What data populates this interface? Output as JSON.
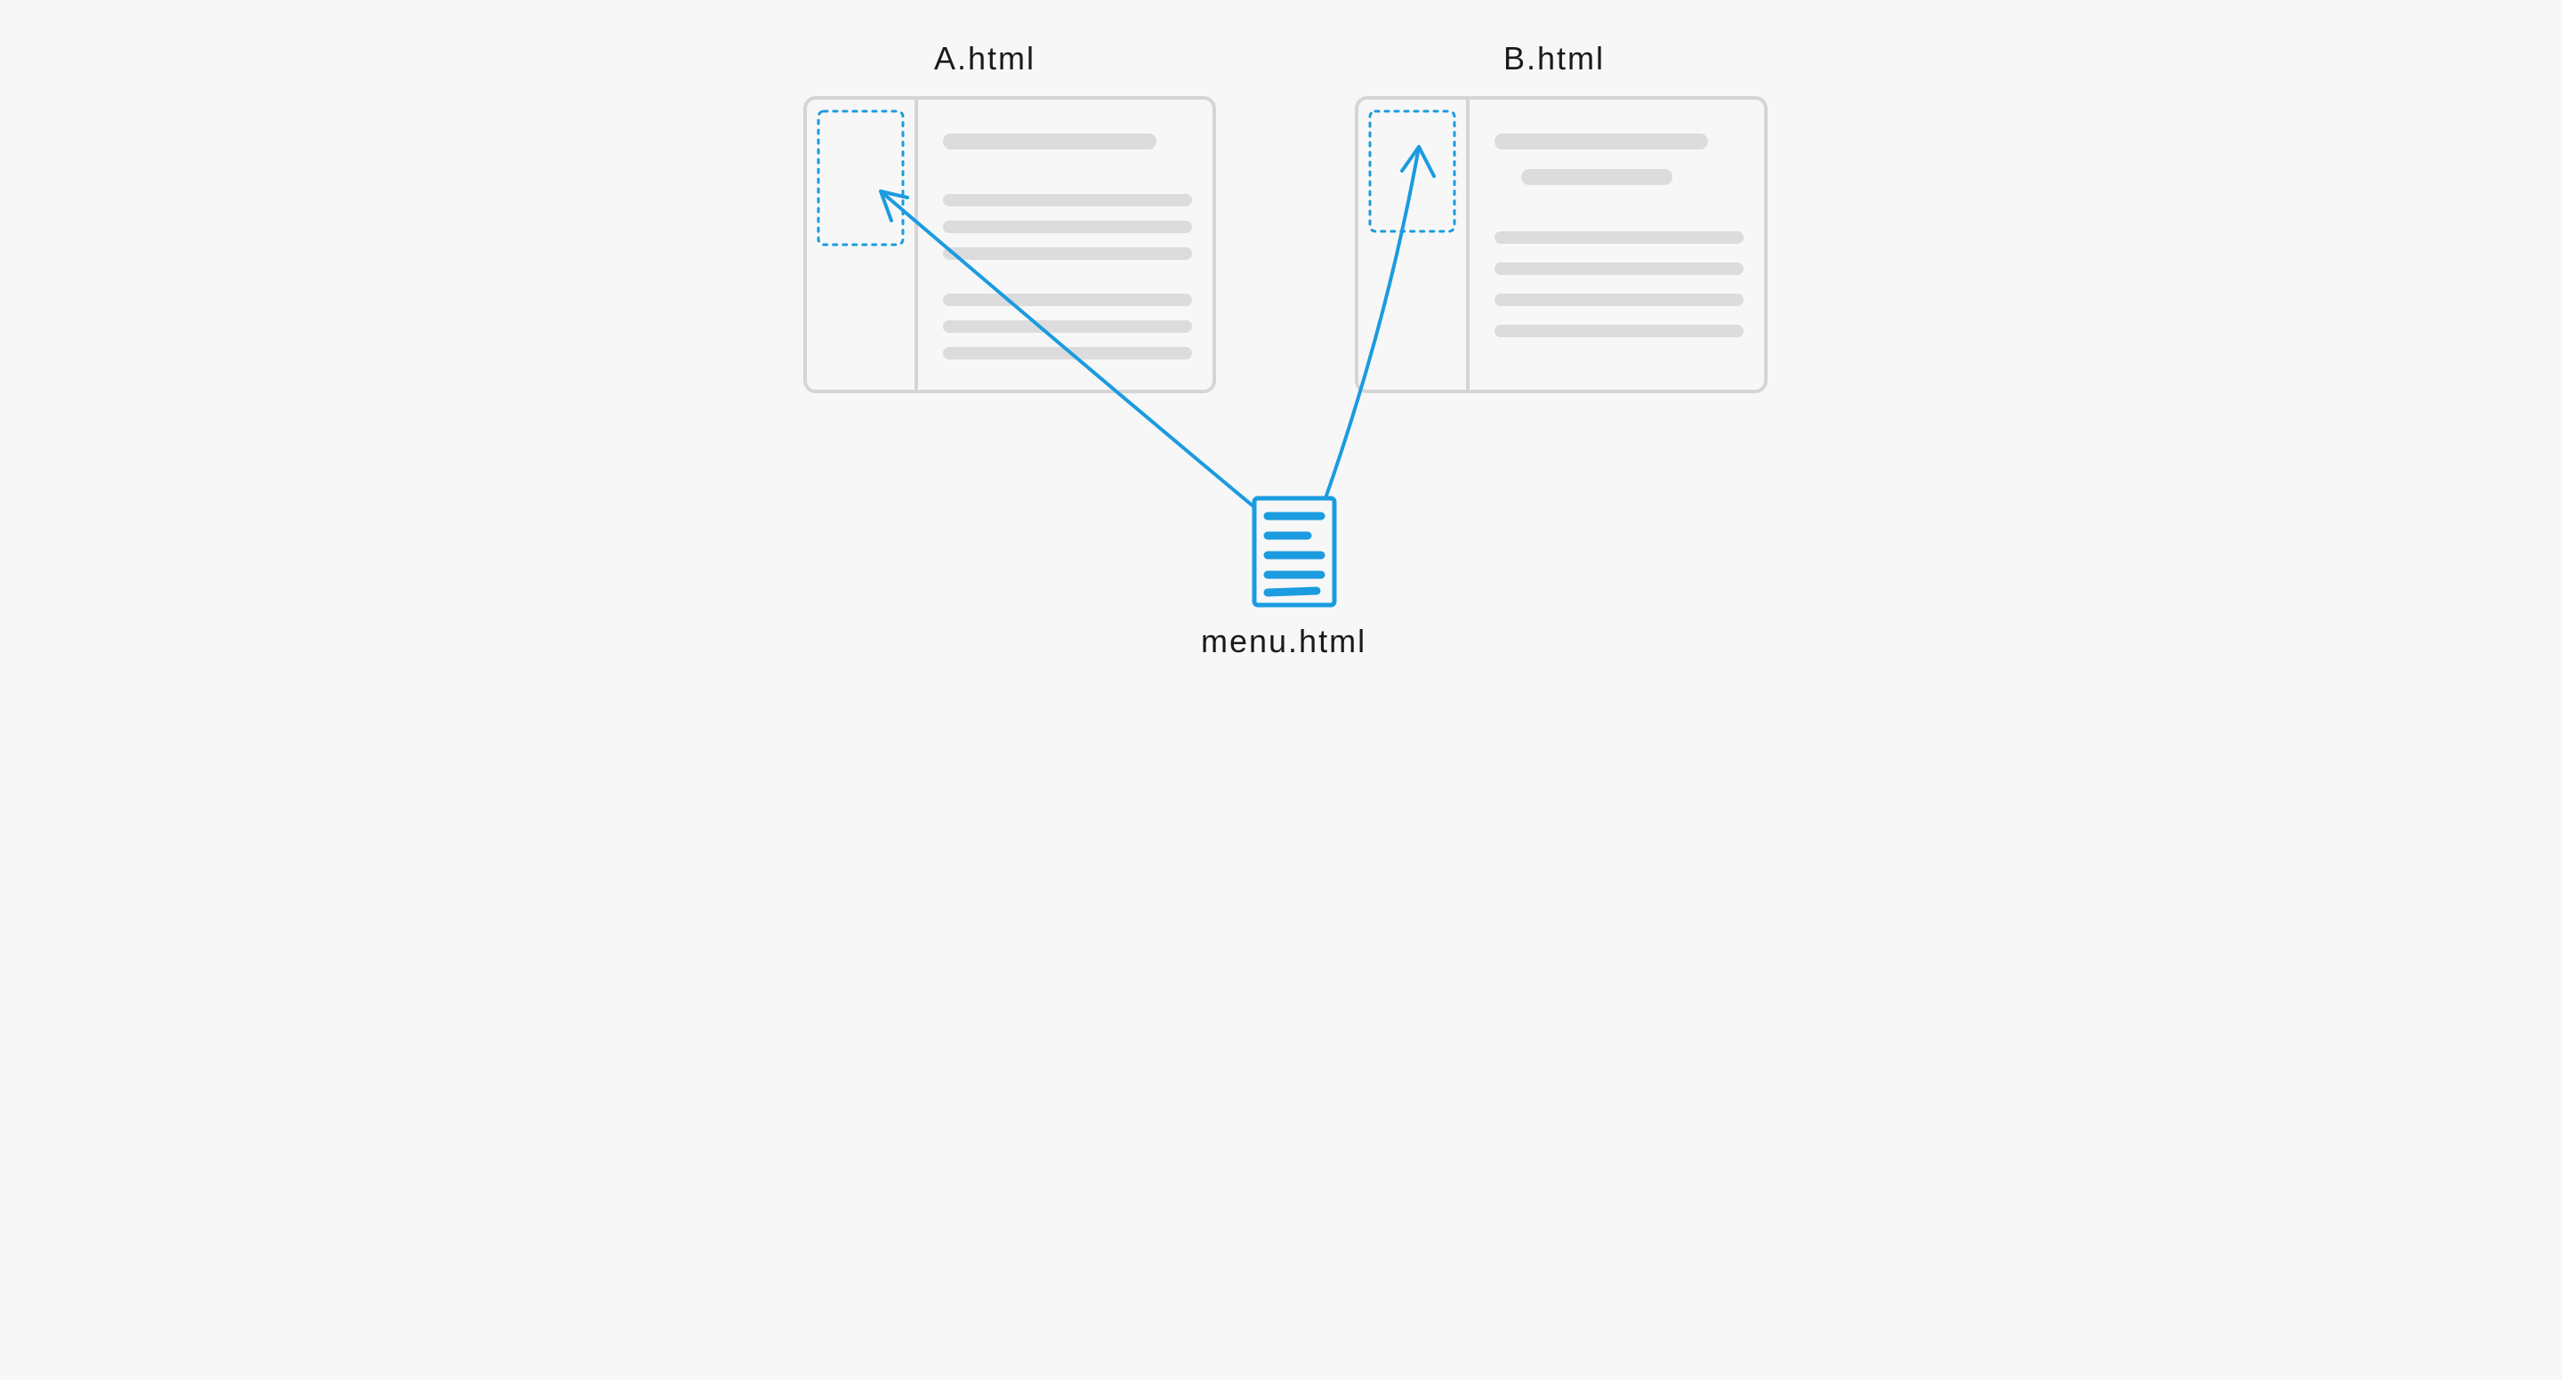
{
  "labels": {
    "pageA": "A.html",
    "pageB": "B.html",
    "menu": "menu.html"
  },
  "colors": {
    "wireframe": "#d5d5d5",
    "highlight": "#1b9be0",
    "text": "#1a1a1a",
    "placeholderFill": "#dcdcdc"
  },
  "diagram": {
    "description": "A shared partial (menu.html) is included into two pages (A.html and B.html) at a highlighted region in each page's sidebar.",
    "nodes": [
      {
        "id": "pageA",
        "type": "page",
        "hasSidebarInclude": true
      },
      {
        "id": "pageB",
        "type": "page",
        "hasSidebarInclude": true
      },
      {
        "id": "menu",
        "type": "partial"
      }
    ],
    "edges": [
      {
        "from": "menu",
        "to": "pageA"
      },
      {
        "from": "menu",
        "to": "pageB"
      }
    ]
  }
}
